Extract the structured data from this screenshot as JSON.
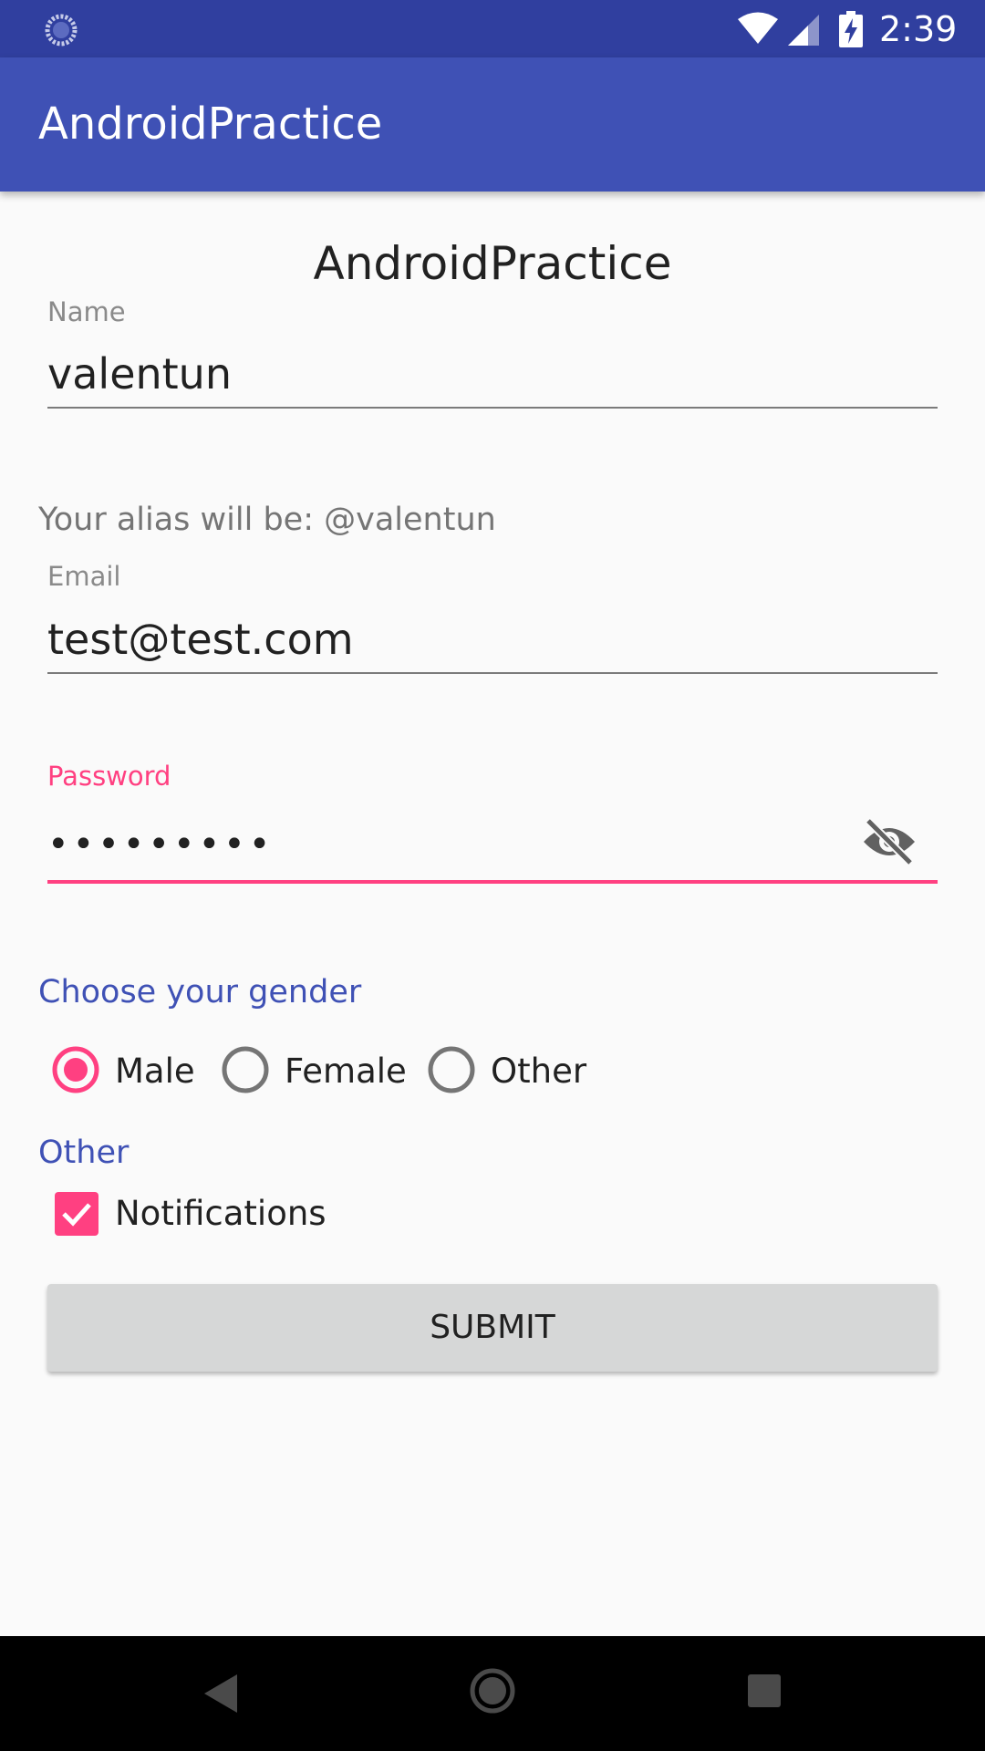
{
  "status_bar": {
    "time": "2:39",
    "icons": [
      "sync-icon",
      "wifi-icon",
      "signal-icon",
      "battery-charging-icon"
    ]
  },
  "app_bar": {
    "title": "AndroidPractice"
  },
  "form": {
    "heading": "AndroidPractice",
    "name": {
      "label": "Name",
      "value": "valentun"
    },
    "alias_text": "Your alias will be: @valentun",
    "email": {
      "label": "Email",
      "value": "test@test.com"
    },
    "password": {
      "label": "Password",
      "value": "•••••••••",
      "toggle_icon": "eye-off-icon"
    },
    "gender": {
      "title": "Choose your gender",
      "options": [
        "Male",
        "Female",
        "Other"
      ],
      "selected": "Male"
    },
    "other": {
      "title": "Other",
      "notifications_label": "Notifications",
      "notifications_checked": true
    },
    "submit_label": "SUBMIT"
  },
  "colors": {
    "primary": "#3f51b5",
    "primary_dark": "#303f9f",
    "accent": "#ff4081",
    "background": "#fafafa"
  },
  "nav_bar": {
    "icons": [
      "back-icon",
      "home-icon",
      "recents-icon"
    ]
  }
}
